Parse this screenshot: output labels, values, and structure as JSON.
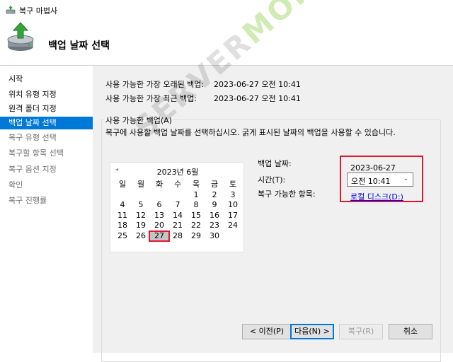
{
  "window": {
    "title": "복구 마법사"
  },
  "header": {
    "title": "백업 날짜 선택"
  },
  "sidebar": {
    "items": [
      {
        "label": "시작",
        "state": "normal"
      },
      {
        "label": "위치 유형 지정",
        "state": "normal"
      },
      {
        "label": "원격 폴더 지정",
        "state": "normal"
      },
      {
        "label": "백업 날짜 선택",
        "state": "active"
      },
      {
        "label": "복구 유형 선택",
        "state": "disabled"
      },
      {
        "label": "복구할 항목 선택",
        "state": "disabled"
      },
      {
        "label": "복구 옵션 지정",
        "state": "disabled"
      },
      {
        "label": "확인",
        "state": "disabled"
      },
      {
        "label": "복구 진행률",
        "state": "disabled"
      }
    ]
  },
  "main": {
    "oldest_label": "사용 가능한 가장 오래된 백업:",
    "oldest_value": "2023-06-27 오전 10:41",
    "newest_label": "사용 가능한 가장 최근 백업:",
    "newest_value": "2023-06-27 오전 10:41",
    "group_label": "사용 가능한 백업(A)",
    "instruction": "복구에 사용할 백업 날짜를 선택하십시오. 굵게 표시된 날짜의 백업을 사용할 수 있습니다."
  },
  "calendar": {
    "prev_glyph": "◂",
    "title": "2023년 6월",
    "weekdays": [
      "일",
      "월",
      "화",
      "수",
      "목",
      "금",
      "토"
    ],
    "weeks": [
      [
        "",
        "",
        "",
        "",
        "1",
        "2",
        "3"
      ],
      [
        "4",
        "5",
        "6",
        "7",
        "8",
        "9",
        "10"
      ],
      [
        "11",
        "12",
        "13",
        "14",
        "15",
        "16",
        "17"
      ],
      [
        "18",
        "19",
        "20",
        "21",
        "22",
        "23",
        "24"
      ],
      [
        "25",
        "26",
        "27",
        "28",
        "29",
        "30",
        ""
      ]
    ],
    "selected_day": "27"
  },
  "details": {
    "date_label": "백업 날짜:",
    "date_value": "2023-06-27",
    "time_label": "시간(T):",
    "time_value": "오전 10:41",
    "items_label": "복구 가능한 항목:",
    "items_link": "로컬 디스크(D:)"
  },
  "watermark": {
    "part1": "SERVER",
    "part2": "MON"
  },
  "buttons": {
    "back": "< 이전(P)",
    "next": "다음(N) >",
    "restore": "복구(R)",
    "cancel": "취소"
  },
  "colors": {
    "accent": "#0078d7",
    "highlight_red": "#e0192b",
    "panel_bg": "#f0f0f0",
    "link": "#0000ee"
  }
}
